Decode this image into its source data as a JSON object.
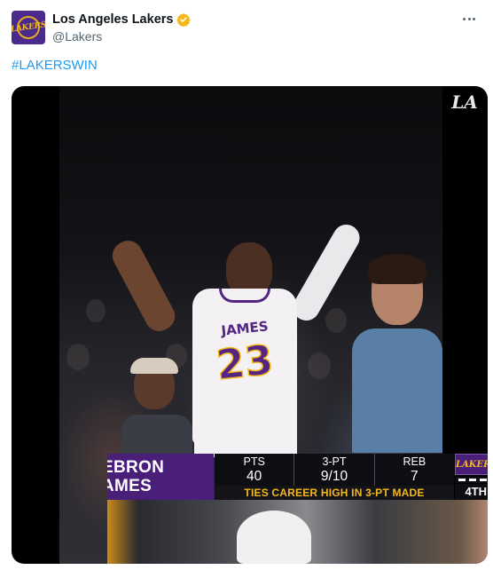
{
  "account": {
    "display_name": "Los Angeles Lakers",
    "handle": "@Lakers",
    "avatar_text": "LAKERS",
    "verified_color": "#f5b81a"
  },
  "tweet": {
    "hashtag": "#LAKERSWIN"
  },
  "video": {
    "watermark": "LA",
    "jersey_name": "JAMES",
    "jersey_number": "23",
    "scorebug": {
      "player_name_line1": "EBRON",
      "player_name_line2": "AMES",
      "stats": [
        {
          "label": "PTS",
          "value": "40"
        },
        {
          "label": "3-PT",
          "value": "9/10"
        },
        {
          "label": "REB",
          "value": "7"
        }
      ],
      "banner": "TIES CAREER HIGH IN 3-PT MADE",
      "team_logo_text": "LAKERS",
      "period": "4TH"
    }
  },
  "colors": {
    "link": "#1d9bf0",
    "lakers_purple": "#552583",
    "lakers_gold": "#f5b81a"
  }
}
